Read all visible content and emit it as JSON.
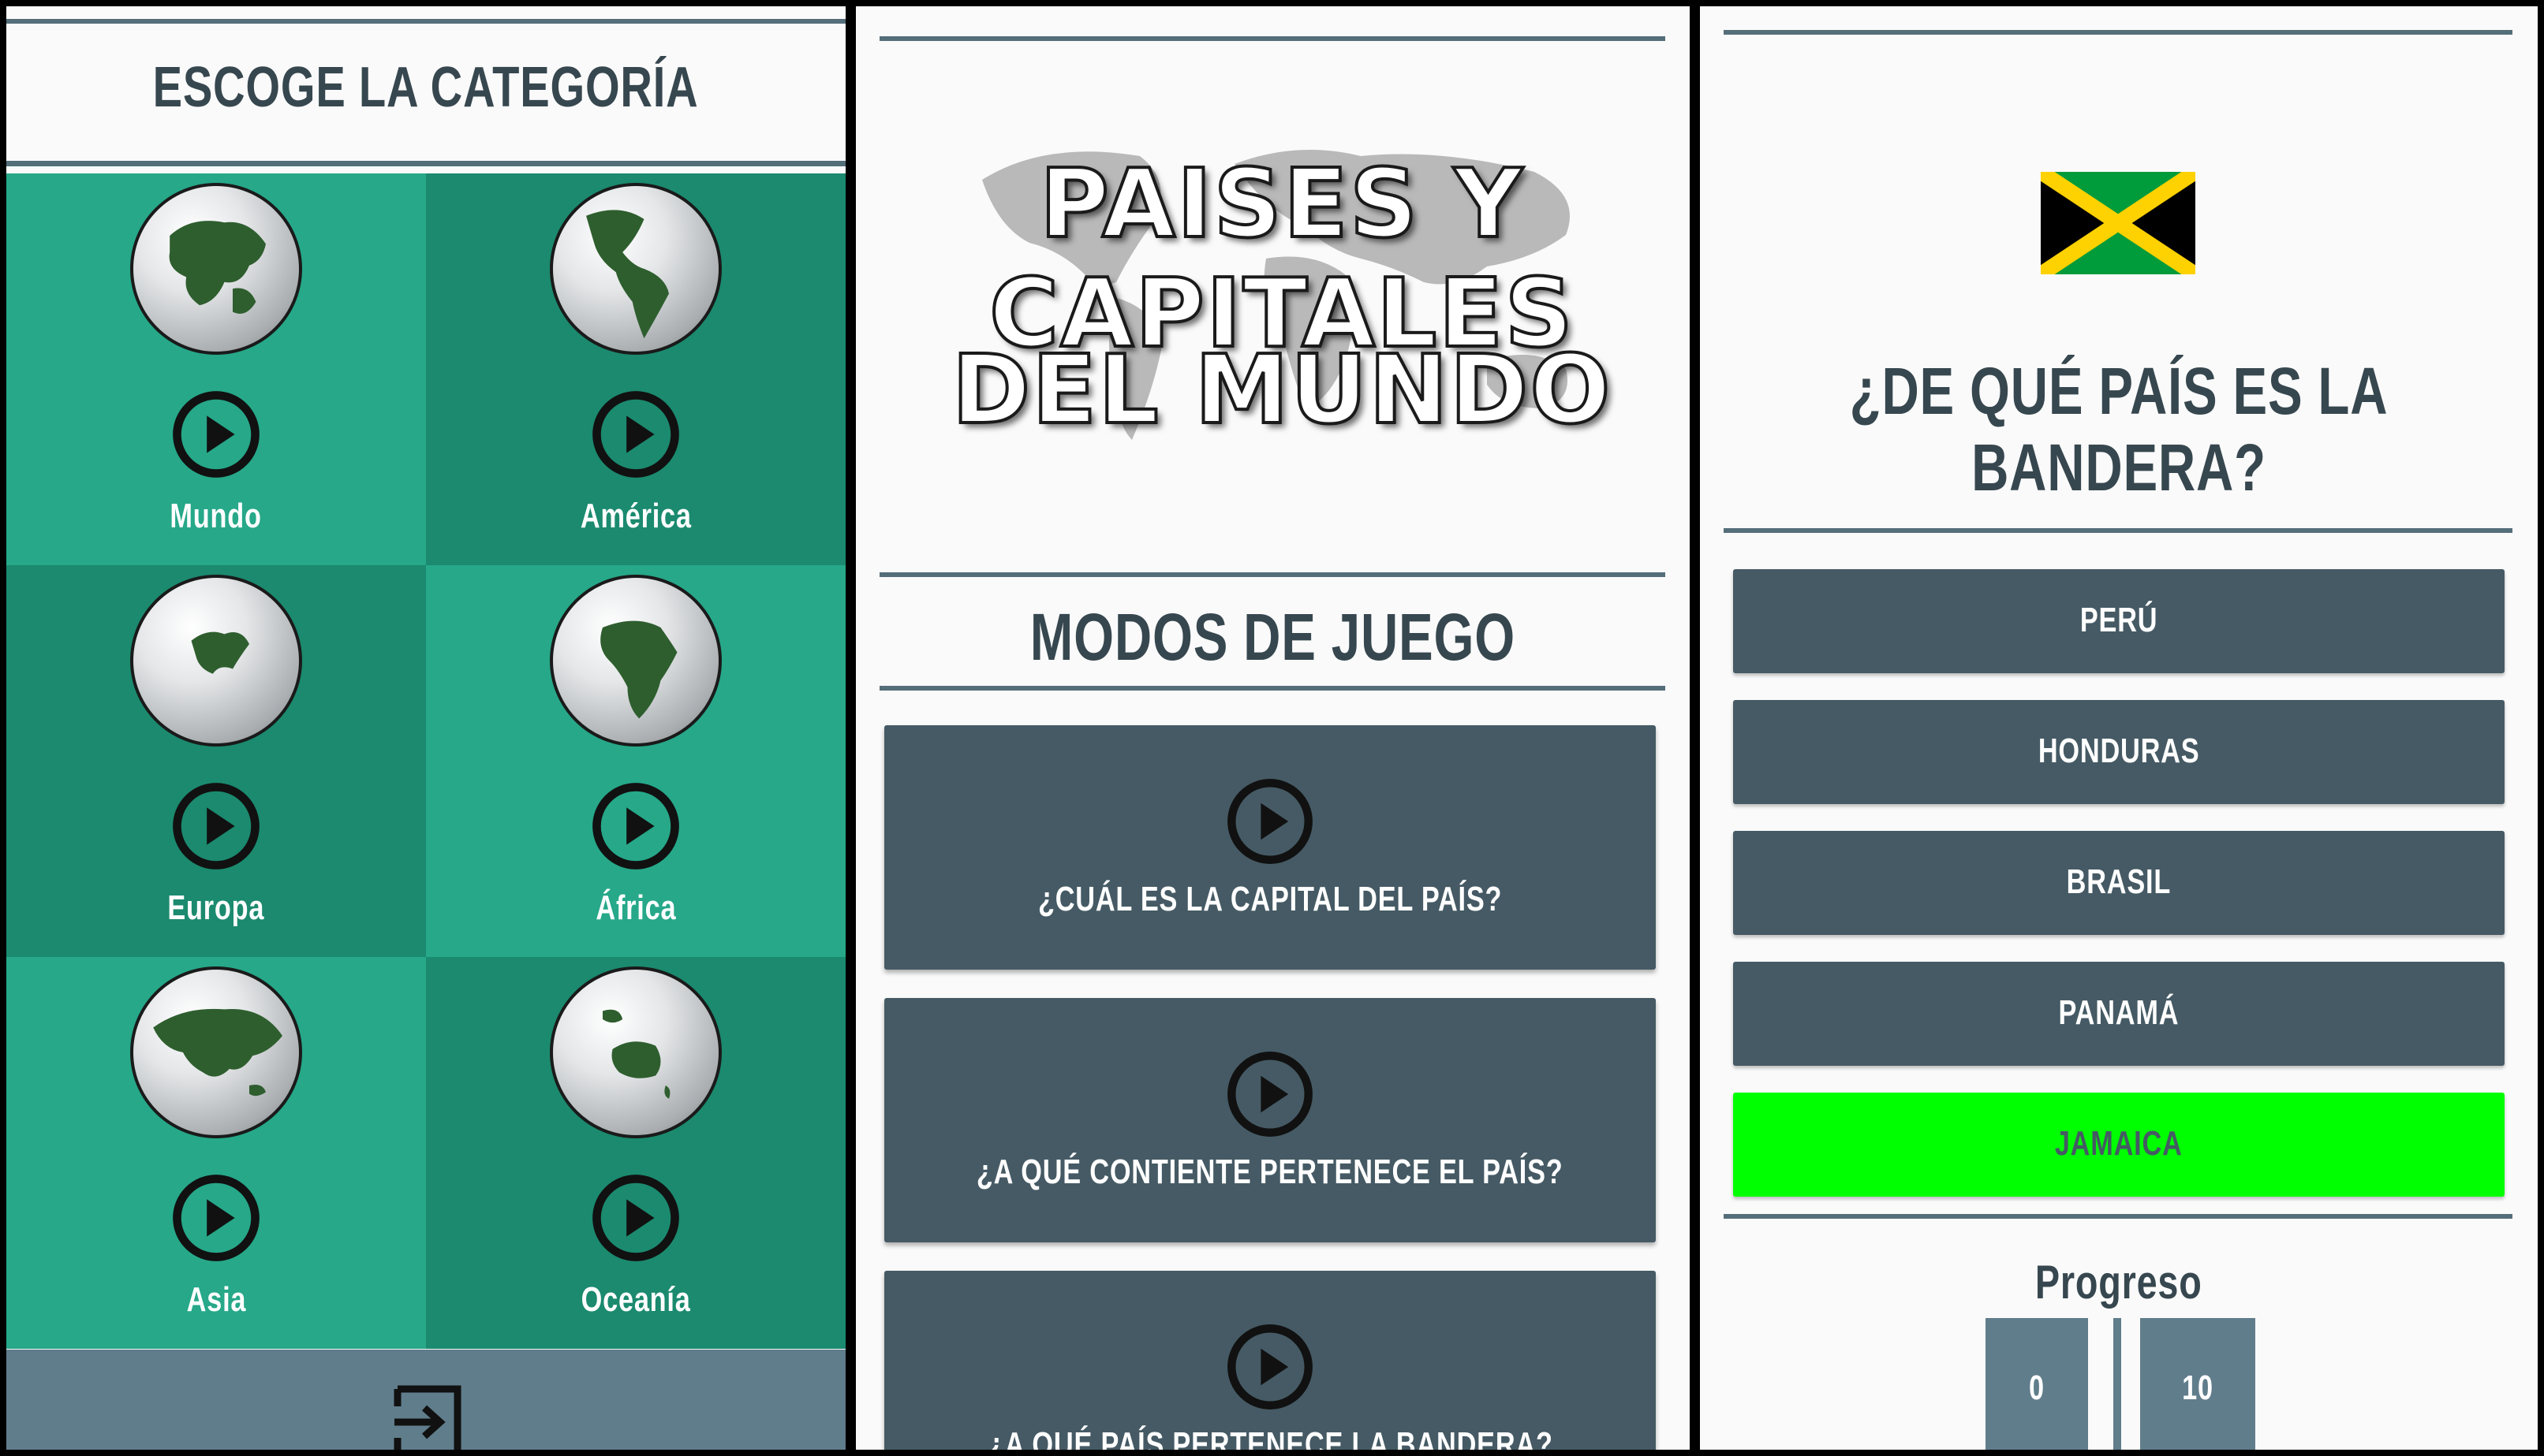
{
  "colors": {
    "teal_light": "#26a889",
    "teal_dark": "#1b8a6f",
    "slate": "#455a64",
    "slate_light": "#607d8b",
    "title_text": "#37474f",
    "correct_green": "#00ff00"
  },
  "category_screen": {
    "title": "ESCOGE LA CATEGORÍA",
    "categories": [
      {
        "label": "Mundo",
        "icon": "globe-world-icon"
      },
      {
        "label": "América",
        "icon": "globe-america-icon"
      },
      {
        "label": "Europa",
        "icon": "globe-europe-icon"
      },
      {
        "label": "África",
        "icon": "globe-africa-icon"
      },
      {
        "label": "Asia",
        "icon": "globe-asia-icon"
      },
      {
        "label": "Oceanía",
        "icon": "globe-oceania-icon"
      }
    ],
    "footer_icon": "exit-icon"
  },
  "home_screen": {
    "logo_line1": "PAISES Y CAPITALES",
    "logo_line2": "DEL MUNDO",
    "section_title": "MODOS DE JUEGO",
    "modes": [
      {
        "label": "¿CUÁL ES LA CAPITAL DEL PAÍS?"
      },
      {
        "label": "¿A QUÉ CONTIENTE PERTENECE EL PAÍS?"
      },
      {
        "label": "¿A QUÉ PAÍS PERTENECE LA BANDERA?"
      }
    ]
  },
  "quiz_screen": {
    "flag_icon": "jamaica-flag-icon",
    "question": "¿DE QUÉ PAÍS ES LA BANDERA?",
    "options": [
      {
        "label": "PERÚ",
        "state": "normal"
      },
      {
        "label": "HONDURAS",
        "state": "normal"
      },
      {
        "label": "BRASIL",
        "state": "normal"
      },
      {
        "label": "PANAMÁ",
        "state": "normal"
      },
      {
        "label": "JAMAICA",
        "state": "correct"
      }
    ],
    "progress_title": "Progreso",
    "progress_current": "0",
    "progress_total": "10"
  }
}
